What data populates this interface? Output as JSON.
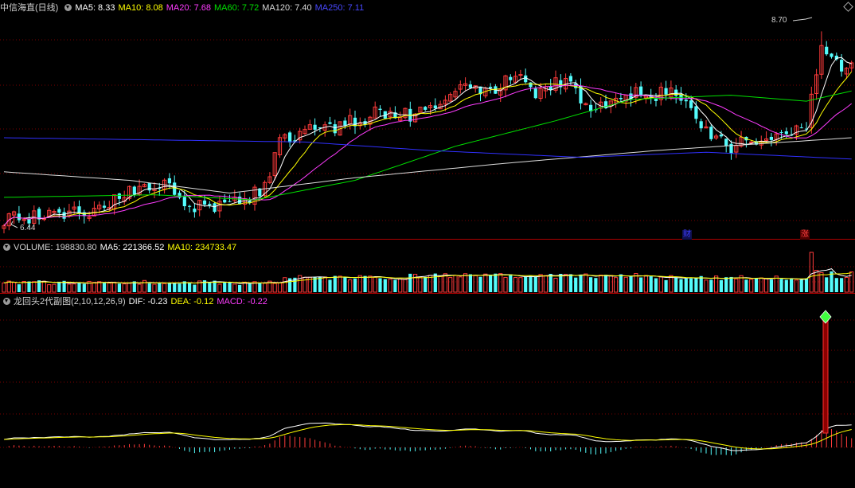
{
  "panel_main": {
    "title": "中信海直(日线)",
    "ma5": "MA5: 8.33",
    "ma10": "MA10: 8.08",
    "ma20": "MA20: 7.68",
    "ma60": "MA60: 7.72",
    "ma120": "MA120: 7.40",
    "ma250": "MA250: 7.11",
    "high_label": "8.70",
    "low_label": "6.44",
    "badge_finance": "财",
    "badge_rise": "涨"
  },
  "panel_volume": {
    "title": "VOLUME: 198830.80",
    "ma5": "MA5: 221366.52",
    "ma10": "MA10: 234733.47"
  },
  "panel_indicator": {
    "title": "龙回头2代副图(2,10,12,26,9)",
    "dif": "DIF: -0.23",
    "dea": "DEA: -0.12",
    "macd": "MACD: -0.22"
  },
  "colors": {
    "up": "#ff3b3b",
    "down": "#54fcfc",
    "ma5": "#ffffff",
    "ma10": "#ffff00",
    "ma20": "#ff3cff",
    "ma60": "#00e000",
    "ma120": "#dcdcdc",
    "ma250": "#3030ff",
    "grid": "#7a0000"
  },
  "chart_data": [
    {
      "type": "candlestick",
      "price_range": [
        6.3,
        8.9
      ],
      "high": 8.7,
      "low": 6.44,
      "anchors": [
        [
          0,
          6.5
        ],
        [
          18,
          6.6
        ],
        [
          27,
          6.85
        ],
        [
          32,
          6.9
        ],
        [
          37,
          6.65
        ],
        [
          45,
          6.65
        ],
        [
          52,
          6.85
        ],
        [
          55,
          7.4
        ],
        [
          62,
          7.55
        ],
        [
          68,
          7.6
        ],
        [
          75,
          7.75
        ],
        [
          82,
          7.7
        ],
        [
          90,
          8.05
        ],
        [
          97,
          8.0
        ],
        [
          102,
          8.2
        ],
        [
          106,
          8.0
        ],
        [
          112,
          8.15
        ],
        [
          117,
          7.7
        ],
        [
          123,
          7.95
        ],
        [
          128,
          7.95
        ],
        [
          134,
          8.0
        ],
        [
          140,
          7.55
        ],
        [
          145,
          7.35
        ],
        [
          150,
          7.45
        ],
        [
          155,
          7.55
        ],
        [
          160,
          7.6
        ],
        [
          163,
          8.45
        ],
        [
          166,
          8.3
        ],
        [
          169,
          8.35
        ]
      ],
      "ma_levels": {
        "MA120": [
          [
            0,
            7.05
          ],
          [
            25,
            6.95
          ],
          [
            45,
            6.8
          ],
          [
            70,
            6.98
          ],
          [
            100,
            7.15
          ],
          [
            130,
            7.3
          ],
          [
            169,
            7.45
          ]
        ],
        "MA250": [
          [
            0,
            7.45
          ],
          [
            60,
            7.4
          ],
          [
            85,
            7.3
          ],
          [
            115,
            7.22
          ],
          [
            140,
            7.28
          ],
          [
            169,
            7.2
          ]
        ],
        "MA60": [
          [
            0,
            6.75
          ],
          [
            30,
            6.78
          ],
          [
            50,
            6.72
          ],
          [
            70,
            6.95
          ],
          [
            90,
            7.35
          ],
          [
            110,
            7.65
          ],
          [
            125,
            7.9
          ],
          [
            145,
            7.95
          ],
          [
            160,
            7.88
          ],
          [
            169,
            8.0
          ]
        ]
      }
    },
    {
      "type": "bar",
      "name": "VOLUME",
      "value": 198830.8,
      "ma5": 221366.52,
      "ma10": 234733.47
    },
    {
      "type": "bar",
      "name": "龙回头2代副图",
      "dif": -0.23,
      "dea": -0.12,
      "macd": -0.22
    }
  ]
}
